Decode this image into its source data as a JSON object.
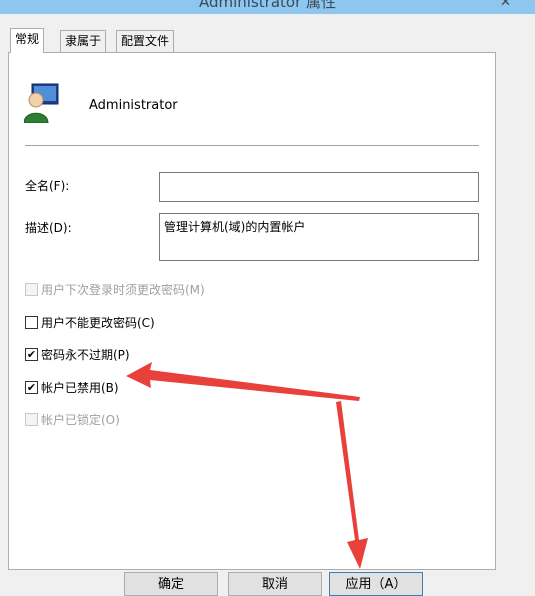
{
  "window": {
    "title": "Administrator 属性",
    "close_glyph": "✕"
  },
  "tabs": [
    {
      "label": "常规",
      "active": true
    },
    {
      "label": "隶属于",
      "active": false
    },
    {
      "label": "配置文件",
      "active": false
    }
  ],
  "user": {
    "name": "Administrator",
    "icon": "user-icon"
  },
  "fields": {
    "fullname": {
      "label": "全名(F):",
      "value": ""
    },
    "description": {
      "label": "描述(D):",
      "value": "管理计算机(域)的内置帐户"
    }
  },
  "checkboxes": [
    {
      "label": "用户下次登录时须更改密码(M)",
      "checked": false,
      "disabled": true
    },
    {
      "label": "用户不能更改密码(C)",
      "checked": false,
      "disabled": false
    },
    {
      "label": "密码永不过期(P)",
      "checked": true,
      "disabled": false
    },
    {
      "label": "帐户已禁用(B)",
      "checked": true,
      "disabled": false
    },
    {
      "label": "帐户已锁定(O)",
      "checked": false,
      "disabled": true
    }
  ],
  "buttons": {
    "ok": "确定",
    "cancel": "取消",
    "apply": "应用（A）"
  },
  "colors": {
    "titlebar": "#8dc6ef",
    "annotation_arrow": "#e8413c",
    "focus_border": "#3c7fb1"
  },
  "check_glyph": "✔"
}
